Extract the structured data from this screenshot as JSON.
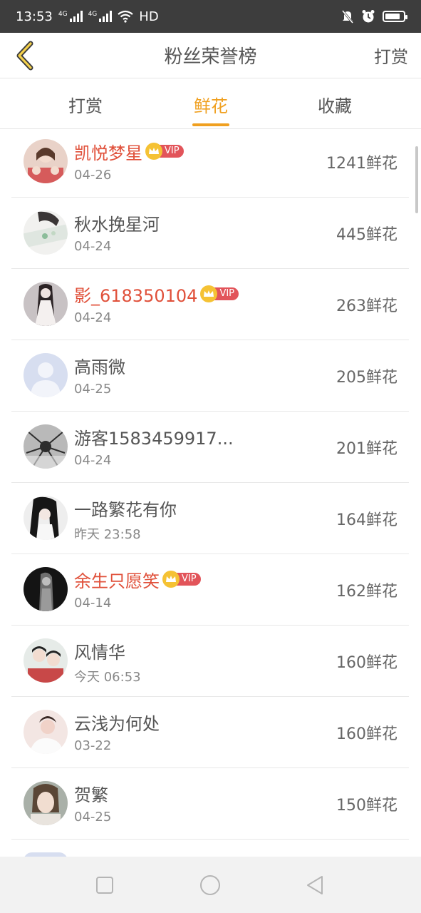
{
  "status_bar": {
    "time": "13:53",
    "signal_1_tag": "4G",
    "signal_2_tag": "4G",
    "hd_label": "HD",
    "icons": [
      "signal-icon",
      "signal-icon",
      "wifi-icon",
      "mute-icon",
      "alarm-icon",
      "battery-icon"
    ]
  },
  "header": {
    "back_icon": "chevron-left-icon",
    "title": "粉丝荣誉榜",
    "right_action": "打赏"
  },
  "tabs": [
    {
      "label": "打赏",
      "active": false
    },
    {
      "label": "鲜花",
      "active": true
    },
    {
      "label": "收藏",
      "active": false
    }
  ],
  "fans": [
    {
      "name": "凯悦梦星",
      "vip": true,
      "date": "04-26",
      "count": "1241鲜花"
    },
    {
      "name": "秋水挽星河",
      "vip": false,
      "date": "04-24",
      "count": "445鲜花"
    },
    {
      "name": "影_618350104",
      "vip": true,
      "date": "04-24",
      "count": "263鲜花"
    },
    {
      "name": "高雨微",
      "vip": false,
      "date": "04-25",
      "count": "205鲜花"
    },
    {
      "name": "游客1583459917...",
      "vip": false,
      "date": "04-24",
      "count": "201鲜花"
    },
    {
      "name": "一路繁花有你",
      "vip": false,
      "date": "昨天 23:58",
      "count": "164鲜花"
    },
    {
      "name": "余生只愿笑",
      "vip": true,
      "date": "04-14",
      "count": "162鲜花"
    },
    {
      "name": "风情华",
      "vip": false,
      "date": "今天 06:53",
      "count": "160鲜花"
    },
    {
      "name": "云浅为何处",
      "vip": false,
      "date": "03-22",
      "count": "160鲜花"
    },
    {
      "name": "贺繁",
      "vip": false,
      "date": "04-25",
      "count": "150鲜花"
    }
  ],
  "vip_label": "VIP",
  "colors": {
    "accent": "#f0a020",
    "vip_name": "#e0503a",
    "vip_tag": "#e2545a",
    "crown": "#f5c234",
    "status_bar": "#3d3d3d"
  },
  "nav_bar": [
    "square-icon",
    "circle-icon",
    "triangle-back-icon"
  ]
}
